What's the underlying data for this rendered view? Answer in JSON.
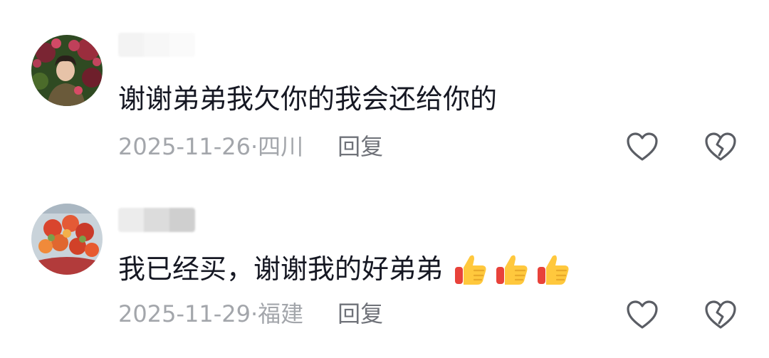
{
  "comments": [
    {
      "text": "谢谢弟弟我欠你的我会还给你的",
      "date": "2025-11-26",
      "location": "四川",
      "reply_label": "回复",
      "like_icon": "heart-outline-icon",
      "dislike_icon": "broken-heart-icon"
    },
    {
      "text": "我已经买，谢谢我的好弟弟",
      "emojis": [
        "thumbs-up",
        "thumbs-up",
        "thumbs-up"
      ],
      "date": "2025-11-29",
      "location": "福建",
      "reply_label": "回复",
      "like_icon": "heart-outline-icon",
      "dislike_icon": "broken-heart-icon"
    }
  ],
  "colors": {
    "text": "#161823",
    "meta": "#a3a6ab",
    "reply": "#6f7279",
    "icon_stroke": "#5a5d64"
  }
}
